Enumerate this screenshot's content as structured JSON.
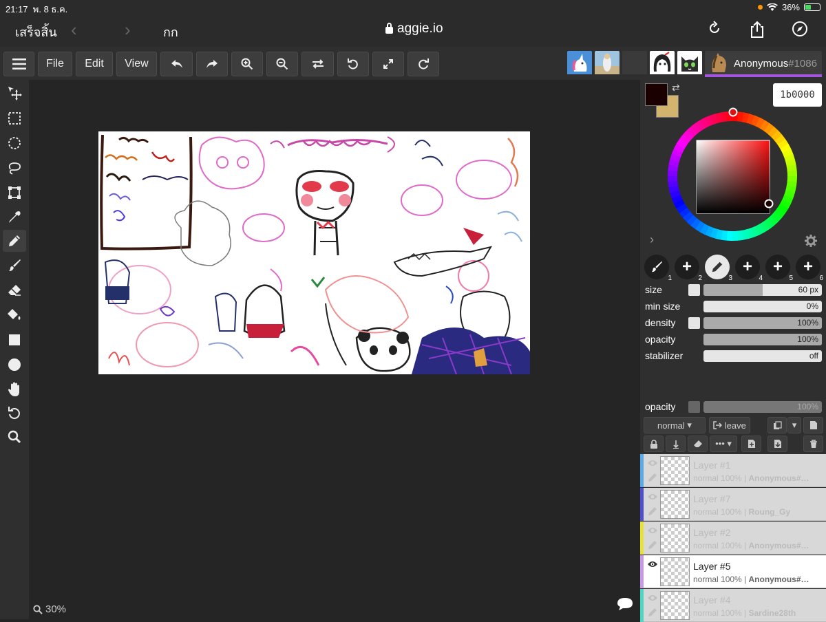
{
  "status_bar": {
    "time": "21:17",
    "date": "พ. 8 ธ.ค.",
    "battery": "36%"
  },
  "browser": {
    "done_label": "เสร็จสิ้น",
    "tab_text": "กก",
    "url": "aggie.io"
  },
  "toolbar": {
    "file_label": "File",
    "edit_label": "Edit",
    "view_label": "View",
    "user_name": "Anonymous",
    "user_number": "#1086"
  },
  "users": [
    {
      "icon": "unicorn-avatar",
      "color": "#f2d43a"
    },
    {
      "icon": "photo-avatar",
      "color": "#3fd0b4"
    },
    {
      "icon": "blank-avatar",
      "color": "#2f7fd8"
    },
    {
      "icon": "anime-avatar",
      "color": "#3b6ee0"
    },
    {
      "icon": "cat-avatar",
      "color": "#e03c3c"
    }
  ],
  "color": {
    "foreground": "#1b0000",
    "background": "#d3b46e",
    "hex_value": "1b0000"
  },
  "brush_slots": [
    {
      "number": "1",
      "icon": "brush-icon"
    },
    {
      "number": "2",
      "icon": "plus-icon"
    },
    {
      "number": "3",
      "icon": "pen-icon"
    },
    {
      "number": "4",
      "icon": "plus-icon"
    },
    {
      "number": "5",
      "icon": "plus-icon"
    },
    {
      "number": "6",
      "icon": "plus-icon"
    }
  ],
  "settings": {
    "size": {
      "label": "size",
      "value": "60 px",
      "fraction": 0.5
    },
    "min_size": {
      "label": "min size",
      "value": "0%",
      "fraction": 0
    },
    "density": {
      "label": "density",
      "value": "100%",
      "fraction": 1
    },
    "opacity": {
      "label": "opacity",
      "value": "100%",
      "fraction": 1
    },
    "stabilizer": {
      "label": "stabilizer",
      "value": "off",
      "fraction": 0
    }
  },
  "layer_opacity": {
    "label": "opacity",
    "value": "100%"
  },
  "layer_controls": {
    "blend_mode": "normal",
    "leave_label": "leave"
  },
  "layers": [
    {
      "name": "Layer #1",
      "mode": "normal 100% |",
      "owner": "Anonymous#…",
      "color": "#5aa9e6",
      "active": false
    },
    {
      "name": "Layer #7",
      "mode": "normal 100% |",
      "owner": "Roung_Gy",
      "color": "#4f4fd0",
      "active": false
    },
    {
      "name": "Layer #2",
      "mode": "normal 100% |",
      "owner": "Anonymous#…",
      "color": "#e6e23a",
      "active": false
    },
    {
      "name": "Layer #5",
      "mode": "normal 100% |",
      "owner": "Anonymous#…",
      "color": "#c79ae6",
      "active": true
    },
    {
      "name": "Layer #4",
      "mode": "normal 100% |",
      "owner": "Sardine28th",
      "color": "#4fd6c0",
      "active": false
    }
  ],
  "zoom": "30%"
}
